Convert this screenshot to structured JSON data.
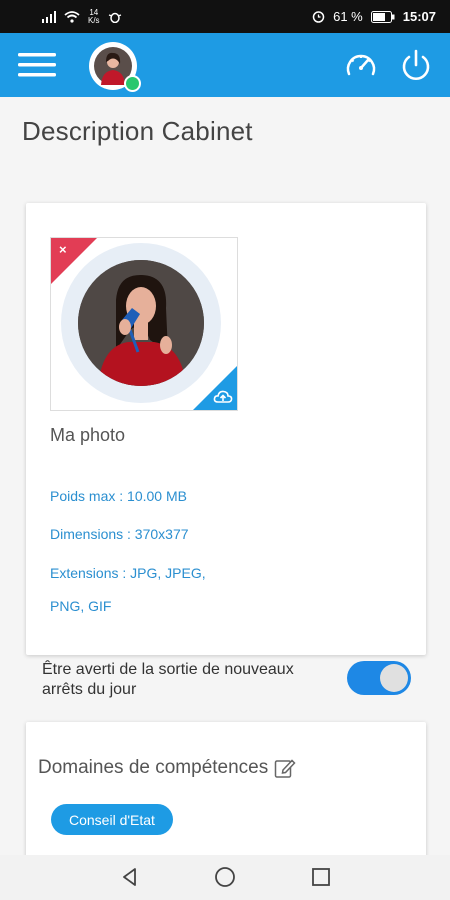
{
  "status_bar": {
    "net_speed": "14",
    "net_unit": "K/s",
    "battery": "61 %",
    "time": "15:07"
  },
  "app_bar": {
    "menu_icon": "hamburger-menu-icon",
    "gauge_icon": "speedometer-icon",
    "power_icon": "power-icon",
    "status_color": "#28c76f",
    "accent": "#1e9be4"
  },
  "page": {
    "title": "Description Cabinet"
  },
  "photo_card": {
    "label": "Ma photo",
    "max_weight": "Poids max : 10.00 MB",
    "dimensions": "Dimensions : 370x377",
    "extensions_line1": "Extensions : JPG, JPEG,",
    "extensions_line2": "PNG, GIF",
    "delete_symbol": "×"
  },
  "notification": {
    "text": "Être averti de la sortie de nouveaux arrêts du jour",
    "enabled": true
  },
  "skills_card": {
    "title": "Domaines de compétences",
    "chips": [
      "Conseil d'Etat"
    ]
  }
}
